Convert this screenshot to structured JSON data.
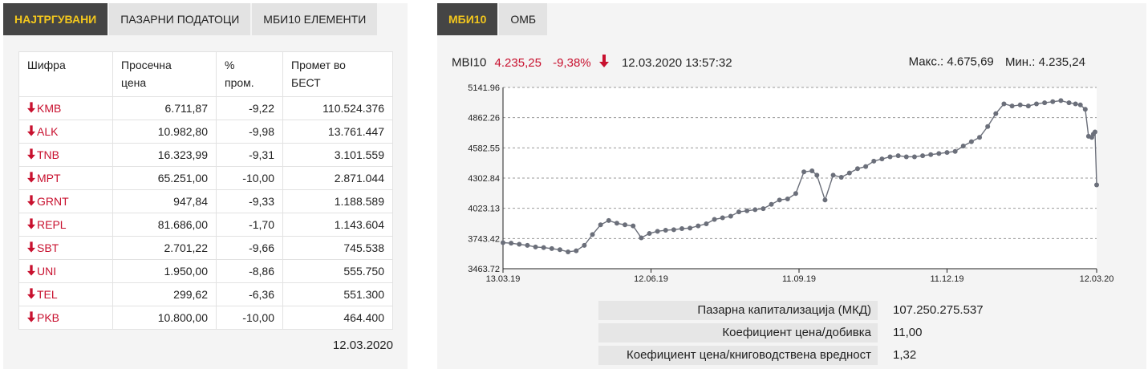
{
  "left": {
    "tabs": [
      "НАЈТРГУВАНИ",
      "ПАЗАРНИ ПОДАТОЦИ",
      "МБИ10 ЕЛЕМЕНТИ"
    ],
    "table": {
      "headers": [
        "Шифра",
        "Просечна\nцена",
        "%\nпром.",
        "Промет во\nБЕСТ"
      ],
      "rows": [
        {
          "symbol": "KMB",
          "price": "6.711,87",
          "change": "-9,22",
          "turnover": "110.524.376"
        },
        {
          "symbol": "ALK",
          "price": "10.982,80",
          "change": "-9,98",
          "turnover": "13.761.447"
        },
        {
          "symbol": "TNB",
          "price": "16.323,99",
          "change": "-9,31",
          "turnover": "3.101.559"
        },
        {
          "symbol": "MPT",
          "price": "65.251,00",
          "change": "-10,00",
          "turnover": "2.871.044"
        },
        {
          "symbol": "GRNT",
          "price": "947,84",
          "change": "-9,33",
          "turnover": "1.188.589"
        },
        {
          "symbol": "REPL",
          "price": "81.686,00",
          "change": "-1,70",
          "turnover": "1.143.604"
        },
        {
          "symbol": "SBT",
          "price": "2.701,22",
          "change": "-9,66",
          "turnover": "745.538"
        },
        {
          "symbol": "UNI",
          "price": "1.950,00",
          "change": "-8,86",
          "turnover": "555.750"
        },
        {
          "symbol": "TEL",
          "price": "299,62",
          "change": "-6,36",
          "turnover": "551.300"
        },
        {
          "symbol": "PKB",
          "price": "10.800,00",
          "change": "-10,00",
          "turnover": "464.400"
        }
      ],
      "arrow_icon": "down-arrow-icon",
      "down_color": "#c8102e"
    },
    "date": "12.03.2020"
  },
  "right": {
    "tabs": [
      "МБИ10",
      "ОМБ"
    ],
    "index": {
      "name": "МВI10",
      "value": "4.235,25",
      "change": "-9,38%",
      "timestamp": "12.03.2020 13:57:32",
      "max_label": "Макс.: 4.675,69",
      "min_label": "Мин.: 4.235,24"
    },
    "info": [
      {
        "label": "Пазарна капитализација (МКД)",
        "value": "107.250.275.537"
      },
      {
        "label": "Коефициент цена/добивка",
        "value": "11,00"
      },
      {
        "label": "Коефициент цена/книговодствена вредност",
        "value": "1,32"
      }
    ]
  },
  "chart_data": {
    "type": "line",
    "ylim": [
      3463.72,
      5141.96
    ],
    "yticks": [
      "5141.96",
      "4862.26",
      "4582.55",
      "4302.84",
      "4023.13",
      "3743.42",
      "3463.72"
    ],
    "xticks": [
      "13.03.19",
      "12.06.19",
      "11.09.19",
      "11.12.19",
      "12.03.20"
    ],
    "x_range": [
      "13.03.19",
      "12.03.20"
    ],
    "grid": true,
    "line_color": "#6b6f7a",
    "series": [
      {
        "x": [
          "13.03.19",
          "18.03.19",
          "23.03.19",
          "28.03.19",
          "02.04.19",
          "07.04.19",
          "12.04.19",
          "17.04.19",
          "22.04.19",
          "27.04.19",
          "02.05.19",
          "07.05.19",
          "12.05.19",
          "17.05.19",
          "22.05.19",
          "27.05.19",
          "01.06.19",
          "06.06.19",
          "11.06.19",
          "16.06.19",
          "21.06.19",
          "26.06.19",
          "01.07.19",
          "06.07.19",
          "11.07.19",
          "16.07.19",
          "21.07.19",
          "26.07.19",
          "31.07.19",
          "05.08.19",
          "10.08.19",
          "15.08.19",
          "20.08.19",
          "25.08.19",
          "30.08.19",
          "04.09.19",
          "09.09.19",
          "14.09.19",
          "19.09.19",
          "22.09.19",
          "27.09.19",
          "02.10.19",
          "07.10.19",
          "12.10.19",
          "17.10.19",
          "22.10.19",
          "27.10.19",
          "01.11.19",
          "06.11.19",
          "11.11.19",
          "16.11.19",
          "21.11.19",
          "26.11.19",
          "01.12.19",
          "06.12.19",
          "11.12.19",
          "16.12.19",
          "21.12.19",
          "26.12.19",
          "31.12.19",
          "05.01.20",
          "10.01.20",
          "15.01.20",
          "20.01.20",
          "25.01.20",
          "30.01.20",
          "04.02.20",
          "09.02.20",
          "14.02.20",
          "19.02.20",
          "24.02.20",
          "28.02.20",
          "02.03.20",
          "05.03.20",
          "07.03.20",
          "09.03.20",
          "10.03.20",
          "11.03.20",
          "12.03.20"
        ],
        "y": [
          3705,
          3700,
          3690,
          3680,
          3665,
          3660,
          3650,
          3640,
          3620,
          3630,
          3680,
          3780,
          3870,
          3910,
          3885,
          3870,
          3860,
          3750,
          3790,
          3810,
          3820,
          3825,
          3835,
          3840,
          3860,
          3880,
          3920,
          3935,
          3950,
          3990,
          4000,
          4010,
          4020,
          4060,
          4100,
          4110,
          4160,
          4360,
          4370,
          4330,
          4100,
          4330,
          4310,
          4350,
          4390,
          4410,
          4460,
          4480,
          4500,
          4510,
          4500,
          4500,
          4510,
          4520,
          4530,
          4540,
          4550,
          4600,
          4640,
          4680,
          4780,
          4900,
          4990,
          4970,
          4980,
          4970,
          4990,
          5000,
          5010,
          5020,
          5000,
          4990,
          4980,
          4940,
          4690,
          4680,
          4710,
          4730,
          4240
        ]
      }
    ]
  }
}
